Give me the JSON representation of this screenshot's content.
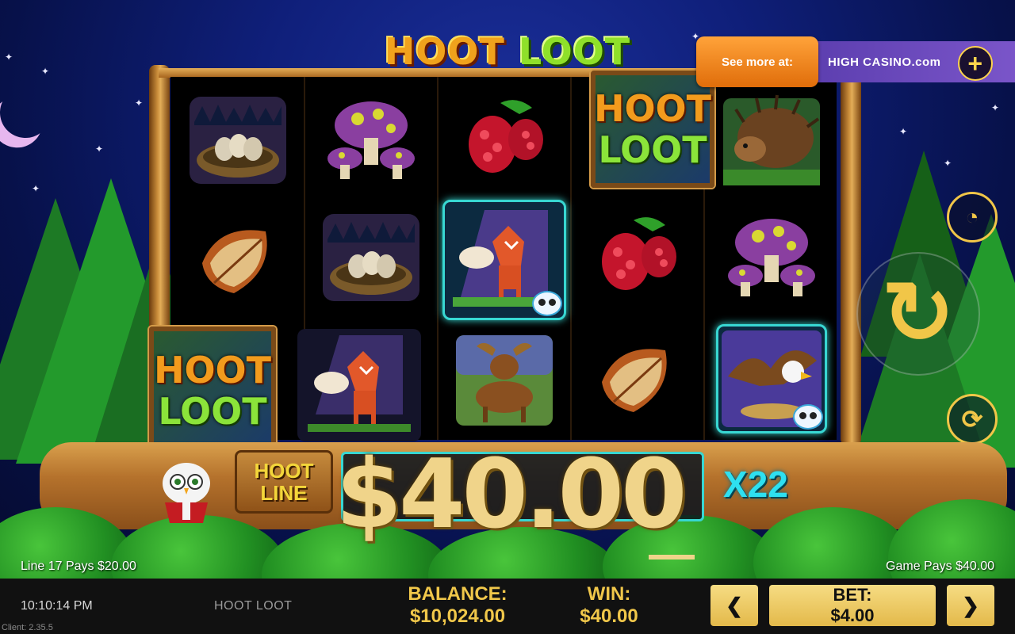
{
  "game": {
    "title_hoot": "HOOT",
    "title_loot": "LOOT",
    "name": "HOOT LOOT"
  },
  "promo": {
    "label": "See more at:",
    "brand": "HIGH CASINO.com",
    "plus_icon": "+"
  },
  "reels": {
    "wild_word_1": "HOOT",
    "wild_word_2": "LOOT",
    "symbols": [
      [
        "nest",
        "leaf",
        "wild"
      ],
      [
        "mushrooms",
        "nest",
        "fox"
      ],
      [
        "raspberry",
        "fox-highlighted",
        "moose"
      ],
      [
        "wild",
        "raspberry",
        "leaf"
      ],
      [
        "porcupine",
        "mushrooms",
        "eagle-highlighted"
      ]
    ]
  },
  "win_display": {
    "hoot_line_1": "HOOT",
    "hoot_line_2": "LINE",
    "amount": "$40.00",
    "multiplier": "X22"
  },
  "status": {
    "line_pays": "Line 17 Pays $20.00",
    "game_pays": "Game Pays $40.00"
  },
  "bottom_bar": {
    "time": "10:10:14 PM",
    "client": "Client: 2.35.5",
    "balance_label": "BALANCE:",
    "balance_value": "$10,024.00",
    "win_label": "WIN:",
    "win_value": "$40.00",
    "bet_label": "BET:",
    "bet_value": "$4.00",
    "bet_down": "❮",
    "bet_up": "❯"
  },
  "colors": {
    "sky": "#0f1f7a",
    "gold": "#f0c74a",
    "cyan_highlight": "#38d7d2",
    "promo_orange": "#f28a1e",
    "promo_purple": "#6a48bd"
  },
  "icons": {
    "speed": "speedometer-icon",
    "spin": "spin-arrow-icon",
    "autoplay": "autoplay-icon"
  }
}
